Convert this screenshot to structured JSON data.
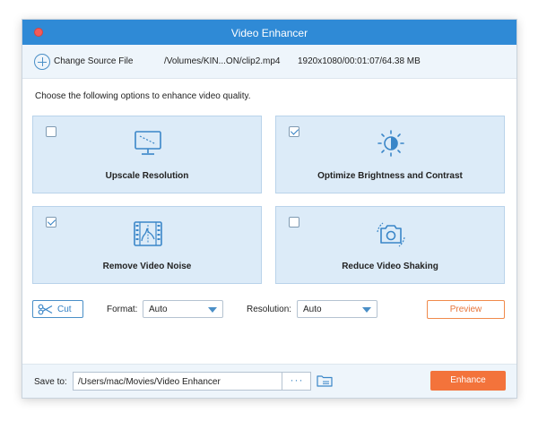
{
  "window": {
    "title": "Video Enhancer"
  },
  "source": {
    "change_label": "Change Source File",
    "file_path": "/Volumes/KIN...ON/clip2.mp4",
    "file_meta": "1920x1080/00:01:07/64.38 MB"
  },
  "instruction": "Choose the following options to enhance video quality.",
  "options": [
    {
      "label": "Upscale Resolution",
      "checked": false,
      "icon": "monitor-icon"
    },
    {
      "label": "Optimize Brightness and Contrast",
      "checked": true,
      "icon": "brightness-icon"
    },
    {
      "label": "Remove Video Noise",
      "checked": true,
      "icon": "film-noise-icon"
    },
    {
      "label": "Reduce Video Shaking",
      "checked": false,
      "icon": "camera-stabilize-icon"
    }
  ],
  "toolbar": {
    "cut_label": "Cut",
    "format_label": "Format:",
    "format_value": "Auto",
    "resolution_label": "Resolution:",
    "resolution_value": "Auto",
    "preview_label": "Preview"
  },
  "bottom": {
    "save_label": "Save to:",
    "save_path": "/Users/mac/Movies/Video Enhancer",
    "browse_label": "···",
    "enhance_label": "Enhance"
  },
  "colors": {
    "titlebar": "#2f8ad6",
    "accent": "#4a8fc7",
    "card_bg": "#dcebf8",
    "enhance": "#f3733b"
  }
}
